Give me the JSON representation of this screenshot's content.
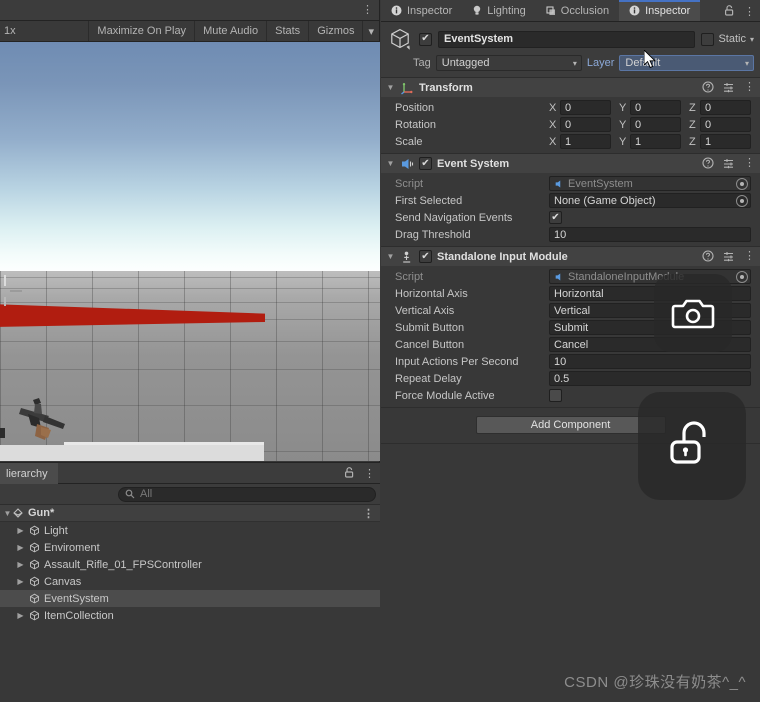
{
  "gameview": {
    "toolbar": {
      "scale": "1x",
      "maximize_on_play": "Maximize On Play",
      "mute_audio": "Mute Audio",
      "stats": "Stats",
      "gizmos": "Gizmos",
      "gizmos_caret": "▾",
      "kebab": "⋮"
    }
  },
  "hierarchy": {
    "tab_label": "lierarchy",
    "lock_icon": "ɐ",
    "kebab": "⋮",
    "search_placeholder": "All",
    "search_icon": "⚲",
    "root": {
      "label": "Gun*",
      "expanded": true,
      "triangle": "▼",
      "kebab": "⋮"
    },
    "items": [
      {
        "label": "Light",
        "triangle": "▶",
        "selected": false
      },
      {
        "label": "Enviroment",
        "triangle": "▶",
        "selected": false
      },
      {
        "label": "Assault_Rifle_01_FPSController",
        "triangle": "▶",
        "selected": false
      },
      {
        "label": "Canvas",
        "triangle": "▶",
        "selected": false
      },
      {
        "label": "EventSystem",
        "triangle": "",
        "selected": true
      },
      {
        "label": "ItemCollection",
        "triangle": "▶",
        "selected": false
      }
    ]
  },
  "inspector": {
    "tabs": [
      {
        "label": "Inspector",
        "icon": "ℹ",
        "active": false
      },
      {
        "label": "Lighting",
        "icon": "●",
        "active": false
      },
      {
        "label": "Occlusion",
        "icon": "▣",
        "active": false
      },
      {
        "label": "Inspector",
        "icon": "ℹ",
        "active": true
      }
    ],
    "lock_icon": "ɐ",
    "kebab": "⋮",
    "object_header": {
      "enabled": true,
      "check": "✔",
      "name": "EventSystem",
      "static_label": "Static",
      "static_checked": false,
      "static_caret": "▾",
      "tag_label": "Tag",
      "tag_value": "Untagged",
      "layer_label": "Layer",
      "layer_value": "Default",
      "caret": "▾"
    },
    "components": [
      {
        "name": "Transform",
        "expanded": true,
        "triangle": "▼",
        "has_toggle": false,
        "help_icon": "?",
        "preset_icon": "≡",
        "kebab": "⋮",
        "vector_rows": [
          {
            "label": "Position",
            "axes": [
              "X",
              "Y",
              "Z"
            ],
            "values": [
              "0",
              "0",
              "0"
            ]
          },
          {
            "label": "Rotation",
            "axes": [
              "X",
              "Y",
              "Z"
            ],
            "values": [
              "0",
              "0",
              "0"
            ]
          },
          {
            "label": "Scale",
            "axes": [
              "X",
              "Y",
              "Z"
            ],
            "values": [
              "1",
              "1",
              "1"
            ]
          }
        ],
        "rows": []
      },
      {
        "name": "Event System",
        "expanded": true,
        "triangle": "▼",
        "has_toggle": true,
        "toggle_checked": true,
        "check": "✔",
        "help_icon": "?",
        "preset_icon": "≡",
        "kebab": "⋮",
        "vector_rows": [],
        "rows": [
          {
            "label": "Script",
            "type": "objref",
            "value": "EventSystem",
            "dim": true,
            "has_picker": true
          },
          {
            "label": "First Selected",
            "type": "objref",
            "value": "None (Game Object)",
            "dim": false,
            "has_picker": true
          },
          {
            "label": "Send Navigation Events",
            "type": "checkbox",
            "value": true
          },
          {
            "label": "Drag Threshold",
            "type": "text",
            "value": "10"
          }
        ]
      },
      {
        "name": "Standalone Input Module",
        "expanded": true,
        "triangle": "▼",
        "has_toggle": true,
        "toggle_checked": true,
        "check": "✔",
        "help_icon": "?",
        "preset_icon": "≡",
        "kebab": "⋮",
        "vector_rows": [],
        "rows": [
          {
            "label": "Script",
            "type": "objref",
            "value": "StandaloneInputModule",
            "dim": true,
            "has_picker": true
          },
          {
            "label": "Horizontal Axis",
            "type": "text",
            "value": "Horizontal"
          },
          {
            "label": "Vertical Axis",
            "type": "text",
            "value": "Vertical"
          },
          {
            "label": "Submit Button",
            "type": "text",
            "value": "Submit"
          },
          {
            "label": "Cancel Button",
            "type": "text",
            "value": "Cancel"
          },
          {
            "label": "Input Actions Per Second",
            "type": "text",
            "value": "10"
          },
          {
            "label": "Repeat Delay",
            "type": "text",
            "value": "0.5"
          },
          {
            "label": "Force Module Active",
            "type": "checkbox",
            "value": false
          }
        ]
      }
    ],
    "add_component_label": "Add Component"
  },
  "overlays": {
    "camera_icon": "camera-icon",
    "lock_icon": "unlock-icon"
  },
  "watermark": "CSDN @珍珠没有奶茶^_^",
  "colors": {
    "panel_bg": "#383838",
    "header_bg": "#3c3c3c",
    "comp_header_bg": "#424242",
    "field_bg": "#2a2a2a",
    "accent_blue": "#4572c4",
    "layer_highlight": "#4a5a74",
    "selection": "#4c4c4c",
    "red_slab": "#b11d10"
  }
}
